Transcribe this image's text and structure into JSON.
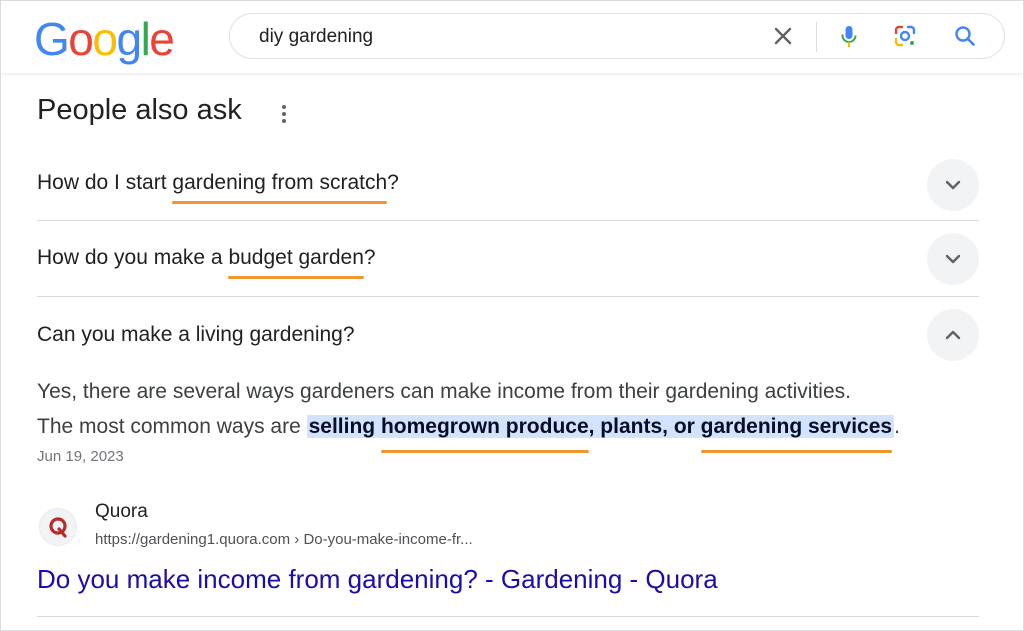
{
  "logo": {
    "letters": [
      "G",
      "o",
      "o",
      "g",
      "l",
      "e"
    ],
    "colors": [
      "#4285F4",
      "#EA4335",
      "#FBBC05",
      "#4285F4",
      "#34A853",
      "#EA4335"
    ]
  },
  "search": {
    "query": "diy gardening",
    "icons": [
      "close-icon",
      "microphone-icon",
      "lens-icon",
      "search-icon"
    ]
  },
  "paa": {
    "title": "People also ask",
    "questions": [
      {
        "before": "How do I start ",
        "highlight": "gardening from scratch",
        "after": "?",
        "state": "collapsed"
      },
      {
        "before": "How do you make a ",
        "highlight": "budget garden",
        "after": "?",
        "state": "collapsed"
      },
      {
        "text": "Can you make a living gardening?",
        "state": "expanded"
      }
    ],
    "answer": {
      "line1": "Yes, there are several ways gardeners can make income from their gardening activities.",
      "line2_before": "The most common ways are ",
      "bold_part1": "selling ",
      "bold_underlined1": "homegrown produce",
      "bold_part2": ", plants, or ",
      "bold_underlined2": "gardening services",
      "line2_after": ".",
      "date": "Jun 19, 2023"
    },
    "source": {
      "name": "Quora",
      "url": "https://gardening1.quora.com › Do-you-make-income-fr...",
      "title": "Do you make income from gardening? - Gardening - Quora",
      "icon_letter": "Q"
    }
  },
  "colors": {
    "underline_accent": "#f0962e",
    "highlight_bg": "#d3e3fd",
    "link": "#1a0dab"
  }
}
